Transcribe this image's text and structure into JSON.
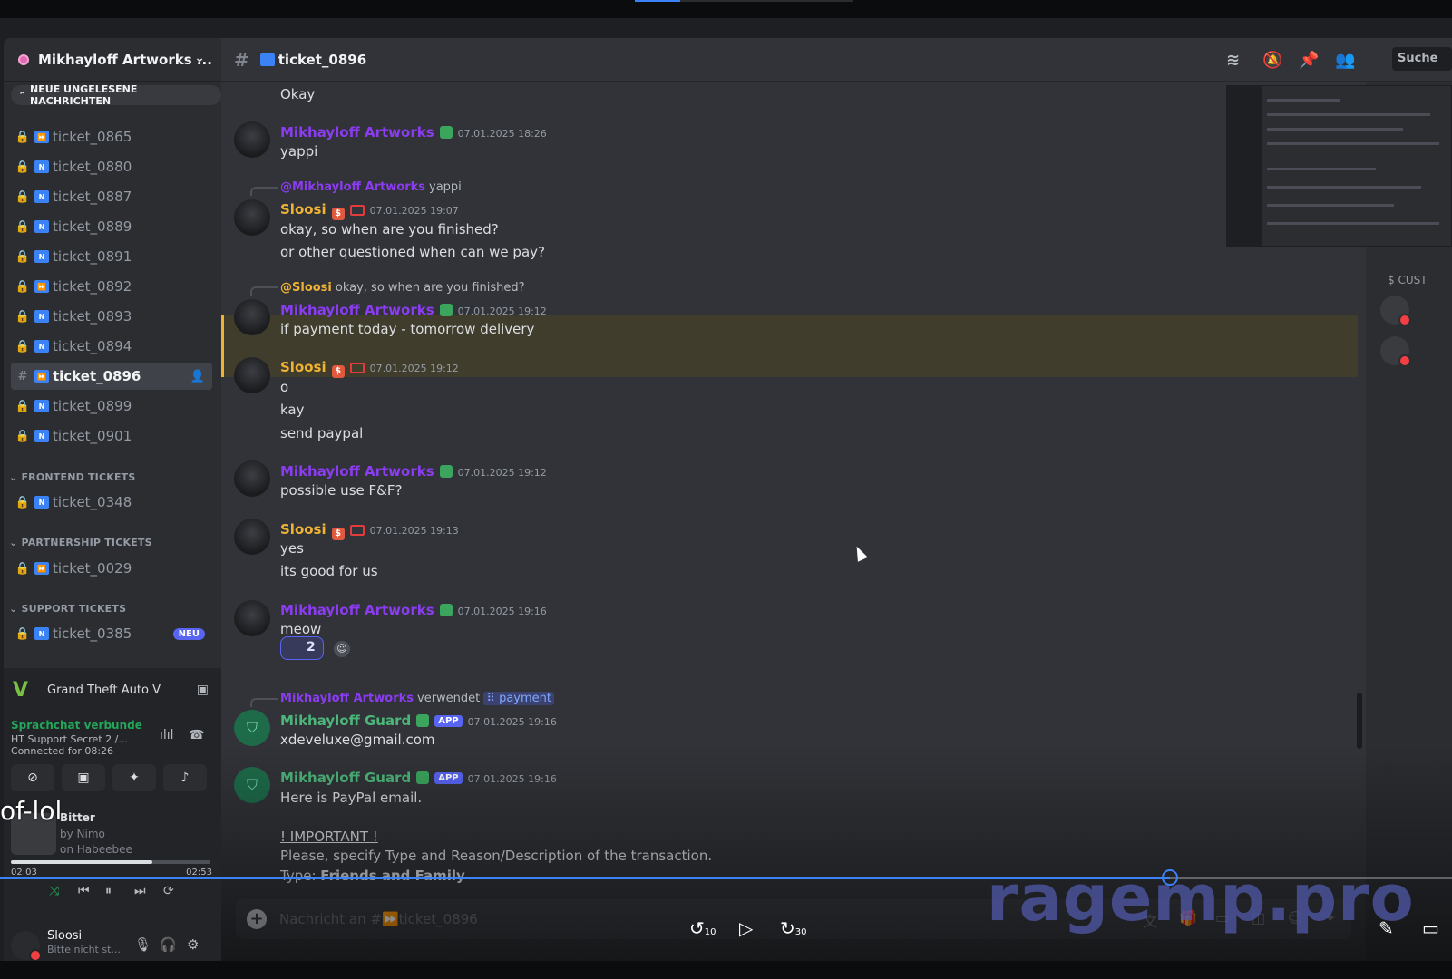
{
  "server": {
    "name": "Mikhayloff Artworks ...",
    "unread_pill": "NEUE UNGELESENE NACHRICHTEN"
  },
  "channels": [
    {
      "name": "ticket_0865",
      "icon": "fast-forward"
    },
    {
      "name": "ticket_0880",
      "icon": "new"
    },
    {
      "name": "ticket_0887",
      "icon": "new"
    },
    {
      "name": "ticket_0889",
      "icon": "new"
    },
    {
      "name": "ticket_0891",
      "icon": "new"
    },
    {
      "name": "ticket_0892",
      "icon": "fast-forward"
    },
    {
      "name": "ticket_0893",
      "icon": "new"
    },
    {
      "name": "ticket_0894",
      "icon": "new"
    },
    {
      "name": "ticket_0896",
      "icon": "fast-forward",
      "active": true
    },
    {
      "name": "ticket_0899",
      "icon": "new"
    },
    {
      "name": "ticket_0901",
      "icon": "new"
    }
  ],
  "categories": {
    "frontend": {
      "label": "FRONTEND TICKETS",
      "channels": [
        "ticket_0348"
      ]
    },
    "partnership": {
      "label": "PARTNERSHIP TICKETS",
      "channels": [
        "ticket_0029"
      ]
    },
    "support": {
      "label": "SUPPORT TICKETS",
      "channels": [
        "ticket_0385"
      ],
      "badge": "NEU"
    }
  },
  "activity": {
    "game": "Grand Theft Auto V"
  },
  "voice": {
    "status": "Sprachchat verbunde",
    "channel": "HT Support Secret 2 /...",
    "connected": "Connected for 08:26"
  },
  "music": {
    "title": "Bitter",
    "by": "by Nimo",
    "on": "on Habeebee",
    "elapsed": "02:03",
    "total": "02:53",
    "progress": 0.71
  },
  "overlay_text": "of-lol",
  "user": {
    "name": "Sloosi",
    "status": "Bitte nicht st..."
  },
  "header": {
    "channel": "ticket_0896",
    "search": "Suche"
  },
  "messages": {
    "m0": {
      "text": "Okay"
    },
    "m1": {
      "author": "Mikhayloff Artworks",
      "time": "07.01.2025 18:26",
      "text": "yappi"
    },
    "m2": {
      "reply_to": "@Mikhayloff Artworks",
      "reply_text": "yappi",
      "author": "Sloosi",
      "time": "07.01.2025 19:07",
      "lines": [
        "okay, so when are you finished?",
        "or other questioned when can we pay?"
      ]
    },
    "m3": {
      "reply_to": "@Sloosi",
      "reply_text": "okay, so when are you finished?",
      "author": "Mikhayloff Artworks",
      "time": "07.01.2025 19:12",
      "text": "if payment today - tomorrow delivery"
    },
    "m4": {
      "author": "Sloosi",
      "time": "07.01.2025 19:12",
      "lines": [
        "o",
        "kay",
        "send paypal"
      ]
    },
    "m5": {
      "author": "Mikhayloff Artworks",
      "time": "07.01.2025 19:12",
      "text": "possible use F&F?"
    },
    "m6": {
      "author": "Sloosi",
      "time": "07.01.2025 19:13",
      "lines": [
        "yes",
        "its good for us"
      ]
    },
    "m7": {
      "author": "Mikhayloff Artworks",
      "time": "07.01.2025 19:16",
      "text": "meow",
      "reaction_count": "2"
    },
    "m8": {
      "cmd_user": "Mikhayloff Artworks",
      "cmd_verb": "verwendet",
      "cmd_name": "payment",
      "author": "Mikhayloff Guard",
      "app": "APP",
      "time": "07.01.2025 19:16",
      "text": "xdeveluxe@gmail.com"
    },
    "m9": {
      "author": "Mikhayloff Guard",
      "app": "APP",
      "time": "07.01.2025 19:16",
      "lines": [
        "Here is PayPal email.",
        "! IMPORTANT !",
        "Please, specify Type and Reason/Description of the transaction."
      ],
      "type_label": "Type:",
      "type_value": "Friends and Family"
    }
  },
  "members": {
    "category": "CUST"
  },
  "composer": {
    "placeholder": "Nachricht an #⏩ticket_0896"
  },
  "video": {
    "rewind": "10",
    "forward": "30"
  },
  "watermark": "ragemp.pro",
  "colors": {
    "accent": "#5865f2",
    "purple_name": "#8b3cf0",
    "gold_name": "#f0b232",
    "guard_name": "#4cb67a",
    "progress": "#3b82f6"
  }
}
